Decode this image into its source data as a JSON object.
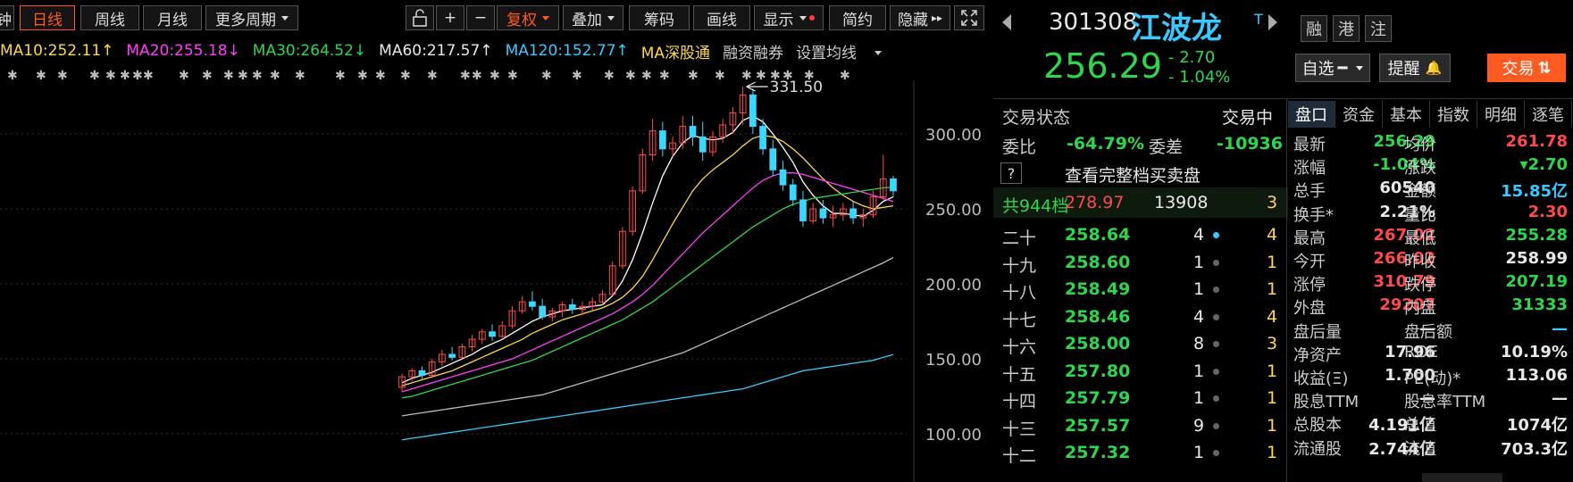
{
  "toolbar": {
    "cut": "钟",
    "daily": "日线",
    "weekly": "周线",
    "monthly": "月线",
    "more_periods": "更多周期",
    "lock_icon": "lock-icon",
    "plus": "+",
    "minus": "−",
    "fuquan": "复权",
    "overlay": "叠加",
    "chips": "筹码",
    "draw": "画线",
    "display": "显示",
    "simple": "简约",
    "hide": "隐藏",
    "expand_icon": "expand-icon"
  },
  "ma_legend": {
    "ma10": "MA10:252.11↑",
    "ma20": "MA20:255.18↓",
    "ma30": "MA30:264.52↓",
    "ma60": "MA60:217.57↑",
    "ma120": "MA120:152.77↑",
    "ma_sgt": "MA深股通",
    "margin": "融资融券",
    "settings": "设置均线"
  },
  "colors": {
    "ma5": "#ffffff",
    "ma10": "#ffd54a",
    "ma20": "#ff3ef7",
    "ma30": "#2ed74a",
    "ma60": "#bbbbbb",
    "ma120": "#3ac8ff",
    "up": "#ff4a4a",
    "down": "#3ad8ff",
    "accent": "#ff5a1f"
  },
  "chart_data": {
    "type": "candlestick",
    "y_ticks": [
      "300.00",
      "250.00",
      "200.00",
      "150.00",
      "100.00"
    ],
    "ylim": [
      100,
      336
    ],
    "peak_label": "331.50",
    "candles": [
      [
        131,
        140,
        128,
        138
      ],
      [
        138,
        144,
        135,
        142
      ],
      [
        142,
        145,
        136,
        139
      ],
      [
        139,
        150,
        138,
        148
      ],
      [
        148,
        156,
        145,
        153
      ],
      [
        153,
        158,
        149,
        151
      ],
      [
        151,
        160,
        150,
        158
      ],
      [
        158,
        166,
        155,
        163
      ],
      [
        163,
        170,
        160,
        168
      ],
      [
        168,
        173,
        162,
        165
      ],
      [
        165,
        175,
        164,
        172
      ],
      [
        172,
        185,
        170,
        182
      ],
      [
        182,
        192,
        180,
        188
      ],
      [
        188,
        195,
        182,
        185
      ],
      [
        185,
        190,
        176,
        178
      ],
      [
        178,
        184,
        175,
        182
      ],
      [
        182,
        188,
        178,
        186
      ],
      [
        186,
        190,
        180,
        183
      ],
      [
        183,
        188,
        179,
        185
      ],
      [
        185,
        191,
        182,
        188
      ],
      [
        188,
        196,
        186,
        193
      ],
      [
        193,
        215,
        192,
        212
      ],
      [
        212,
        238,
        210,
        235
      ],
      [
        235,
        265,
        232,
        262
      ],
      [
        262,
        290,
        260,
        286
      ],
      [
        286,
        310,
        282,
        302
      ],
      [
        302,
        308,
        285,
        290
      ],
      [
        290,
        298,
        285,
        294
      ],
      [
        294,
        312,
        290,
        305
      ],
      [
        305,
        312,
        292,
        298
      ],
      [
        298,
        308,
        282,
        288
      ],
      [
        288,
        302,
        285,
        298
      ],
      [
        298,
        310,
        294,
        306
      ],
      [
        306,
        318,
        300,
        314
      ],
      [
        314,
        331.5,
        306,
        326
      ],
      [
        326,
        330,
        300,
        305
      ],
      [
        305,
        310,
        286,
        290
      ],
      [
        290,
        296,
        272,
        276
      ],
      [
        276,
        282,
        262,
        266
      ],
      [
        266,
        270,
        252,
        256
      ],
      [
        256,
        262,
        238,
        242
      ],
      [
        242,
        254,
        240,
        250
      ],
      [
        250,
        256,
        240,
        244
      ],
      [
        244,
        252,
        238,
        246
      ],
      [
        246,
        254,
        242,
        250
      ],
      [
        250,
        255,
        240,
        244
      ],
      [
        244,
        250,
        238,
        246
      ],
      [
        246,
        262,
        244,
        258
      ],
      [
        258,
        286,
        256,
        270
      ],
      [
        270,
        272,
        258,
        262
      ]
    ],
    "ma": [
      {
        "name": "MA5",
        "values": [
          134,
          137,
          139,
          141,
          144,
          147,
          150,
          153,
          157,
          160,
          163,
          167,
          171,
          175,
          178,
          180,
          182,
          183,
          184,
          185,
          186,
          192,
          202,
          216,
          234,
          254,
          272,
          285,
          294,
          299,
          297,
          296,
          297,
          301,
          309,
          312,
          308,
          300,
          291,
          281,
          268,
          259,
          252,
          247,
          247,
          246,
          245,
          249,
          255,
          258
        ]
      },
      {
        "name": "MA10",
        "values": [
          132,
          134,
          136,
          138,
          140,
          142,
          145,
          148,
          151,
          154,
          157,
          160,
          163,
          167,
          170,
          173,
          176,
          178,
          180,
          182,
          184,
          187,
          191,
          197,
          205,
          216,
          228,
          240,
          251,
          262,
          270,
          276,
          281,
          286,
          292,
          297,
          299,
          298,
          295,
          290,
          284,
          277,
          270,
          264,
          259,
          255,
          252,
          250,
          251,
          252
        ]
      },
      {
        "name": "MA20",
        "values": [
          128,
          130,
          132,
          134,
          136,
          138,
          140,
          142,
          144,
          146,
          148,
          150,
          153,
          156,
          159,
          162,
          165,
          168,
          171,
          174,
          177,
          180,
          184,
          188,
          193,
          199,
          206,
          213,
          220,
          227,
          234,
          240,
          246,
          252,
          258,
          264,
          269,
          272,
          274,
          274,
          273,
          271,
          269,
          267,
          265,
          263,
          261,
          259,
          257,
          255
        ]
      },
      {
        "name": "MA30",
        "values": [
          124,
          125,
          127,
          129,
          131,
          133,
          135,
          137,
          139,
          141,
          143,
          145,
          147,
          149,
          152,
          155,
          158,
          161,
          164,
          167,
          170,
          173,
          176,
          180,
          184,
          188,
          193,
          198,
          203,
          208,
          213,
          218,
          223,
          228,
          233,
          238,
          242,
          246,
          250,
          253,
          255,
          257,
          258,
          259,
          260,
          261,
          262,
          263,
          264,
          264.5
        ]
      },
      {
        "name": "MA60",
        "values": [
          112,
          113,
          114,
          115,
          116,
          117,
          118,
          119,
          120,
          121,
          122,
          123,
          124,
          125,
          126,
          128,
          130,
          132,
          134,
          136,
          138,
          140,
          142,
          144,
          146,
          148,
          150,
          152,
          154,
          157,
          160,
          163,
          166,
          169,
          172,
          175,
          178,
          181,
          184,
          187,
          190,
          193,
          196,
          199,
          202,
          205,
          208,
          211,
          214,
          217.5
        ]
      },
      {
        "name": "MA120",
        "values": [
          96,
          97,
          98,
          99,
          100,
          101,
          102,
          103,
          104,
          105,
          106,
          107,
          108,
          109,
          110,
          111,
          112,
          113,
          114,
          115,
          116,
          117,
          118,
          119,
          120,
          121,
          122,
          123,
          124,
          125,
          126,
          127,
          128,
          129,
          130,
          132,
          134,
          136,
          138,
          140,
          142,
          143,
          144,
          145,
          146,
          147,
          148,
          149,
          151,
          152.8
        ]
      }
    ]
  },
  "quote": {
    "code": "301308",
    "name": "江波龙",
    "t_mark": "T",
    "tags": [
      "融",
      "港",
      "注"
    ],
    "price": "256.29",
    "change": "- 2.70",
    "change_pct": "- 1.04%",
    "watchlist": "自选",
    "alert": "提醒",
    "trade": "交易"
  },
  "trade_status": {
    "label": "交易状态",
    "value": "交易中"
  },
  "weibi": {
    "label": "委比",
    "value": "-64.79%",
    "cha_label": "委差",
    "cha_value": "-10936"
  },
  "full_book": {
    "q": "?",
    "label": "查看完整档买卖盘"
  },
  "total": {
    "label": "共944档",
    "price": "278.97",
    "vol": "13908",
    "count": "3"
  },
  "book": [
    {
      "level": "二十",
      "price": "258.64",
      "vol": "4",
      "n": "4",
      "hl": true
    },
    {
      "level": "十九",
      "price": "258.60",
      "vol": "1",
      "n": "1",
      "hl": false
    },
    {
      "level": "十八",
      "price": "258.49",
      "vol": "1",
      "n": "1",
      "hl": false
    },
    {
      "level": "十七",
      "price": "258.46",
      "vol": "4",
      "n": "4",
      "hl": false
    },
    {
      "level": "十六",
      "price": "258.00",
      "vol": "8",
      "n": "3",
      "hl": false
    },
    {
      "level": "十五",
      "price": "257.80",
      "vol": "1",
      "n": "1",
      "hl": false
    },
    {
      "level": "十四",
      "price": "257.79",
      "vol": "1",
      "n": "1",
      "hl": false
    },
    {
      "level": "十三",
      "price": "257.57",
      "vol": "9",
      "n": "1",
      "hl": false
    },
    {
      "level": "十二",
      "price": "257.32",
      "vol": "1",
      "n": "1",
      "hl": false
    }
  ],
  "panel_tabs": [
    "盘口",
    "资金",
    "基本",
    "指数",
    "明细",
    "逐笔"
  ],
  "stats": [
    {
      "l1": "最新",
      "v1": "256.29",
      "c1": "g",
      "l2": "均价",
      "v2": "261.78",
      "c2": "r"
    },
    {
      "l1": "涨幅",
      "v1": "-1.04%",
      "c1": "g",
      "l2": "涨跌",
      "v2": "▾2.70",
      "c2": "g"
    },
    {
      "l1": "总手",
      "v1": "60540",
      "c1": "w",
      "l2": "金额",
      "v2": "15.85亿",
      "c2": "c"
    },
    {
      "l1": "换手*",
      "v1": "2.21%",
      "c1": "w",
      "l2": "量比",
      "v2": "2.30",
      "c2": "r"
    },
    {
      "l1": "最高",
      "v1": "267.02",
      "c1": "r",
      "l2": "最低",
      "v2": "255.28",
      "c2": "g"
    },
    {
      "l1": "今开",
      "v1": "266.02",
      "c1": "r",
      "l2": "昨收",
      "v2": "258.99",
      "c2": "w"
    },
    {
      "l1": "涨停",
      "v1": "310.79",
      "c1": "r",
      "l2": "跌停",
      "v2": "207.19",
      "c2": "g"
    },
    {
      "l1": "外盘",
      "v1": "29207",
      "c1": "r",
      "l2": "内盘",
      "v2": "31333",
      "c2": "g"
    },
    {
      "l1": "盘后量",
      "v1": "—",
      "c1": "w",
      "l2": "盘后额",
      "v2": "—",
      "c2": "c"
    },
    {
      "l1": "净资产",
      "v1": "17.96",
      "c1": "w",
      "l2": "ROE",
      "v2": "10.19%",
      "c2": "w"
    },
    {
      "l1": "收益(Ξ)",
      "v1": "1.700",
      "c1": "w",
      "l2": "PE(动)*",
      "v2": "113.06",
      "c2": "w"
    },
    {
      "l1": "股息TTM",
      "v1": "—",
      "c1": "w",
      "l2": "股息率TTM",
      "v2": "—",
      "c2": "w"
    },
    {
      "l1": "总股本",
      "v1": "4.191亿",
      "c1": "w",
      "l2": "总值",
      "v2": "1074亿",
      "c2": "w"
    },
    {
      "l1": "流通股",
      "v1": "2.744亿",
      "c1": "w",
      "l2": "流值",
      "v2": "703.3亿",
      "c2": "w"
    }
  ]
}
